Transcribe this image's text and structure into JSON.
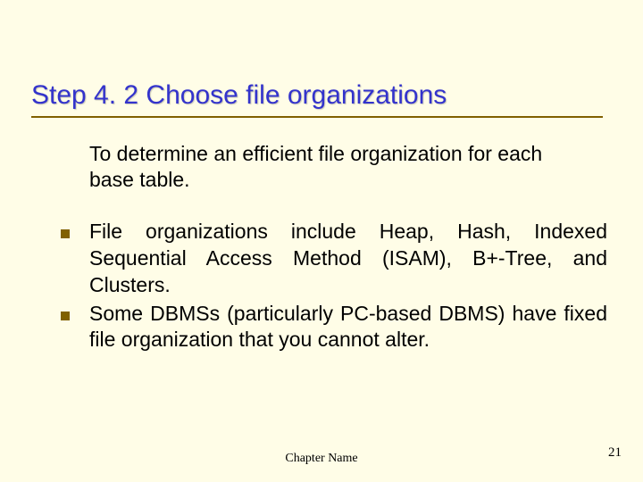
{
  "slide": {
    "title": "Step 4. 2  Choose file organizations",
    "intro": "To determine an efficient file organization for each base table.",
    "bullets": [
      "File organizations include Heap, Hash, Indexed Sequential Access Method (ISAM), B+-Tree, and Clusters.",
      "Some DBMSs (particularly PC-based DBMS) have fixed file organization that you cannot alter."
    ],
    "footer_center": "Chapter Name",
    "footer_page": "21"
  }
}
